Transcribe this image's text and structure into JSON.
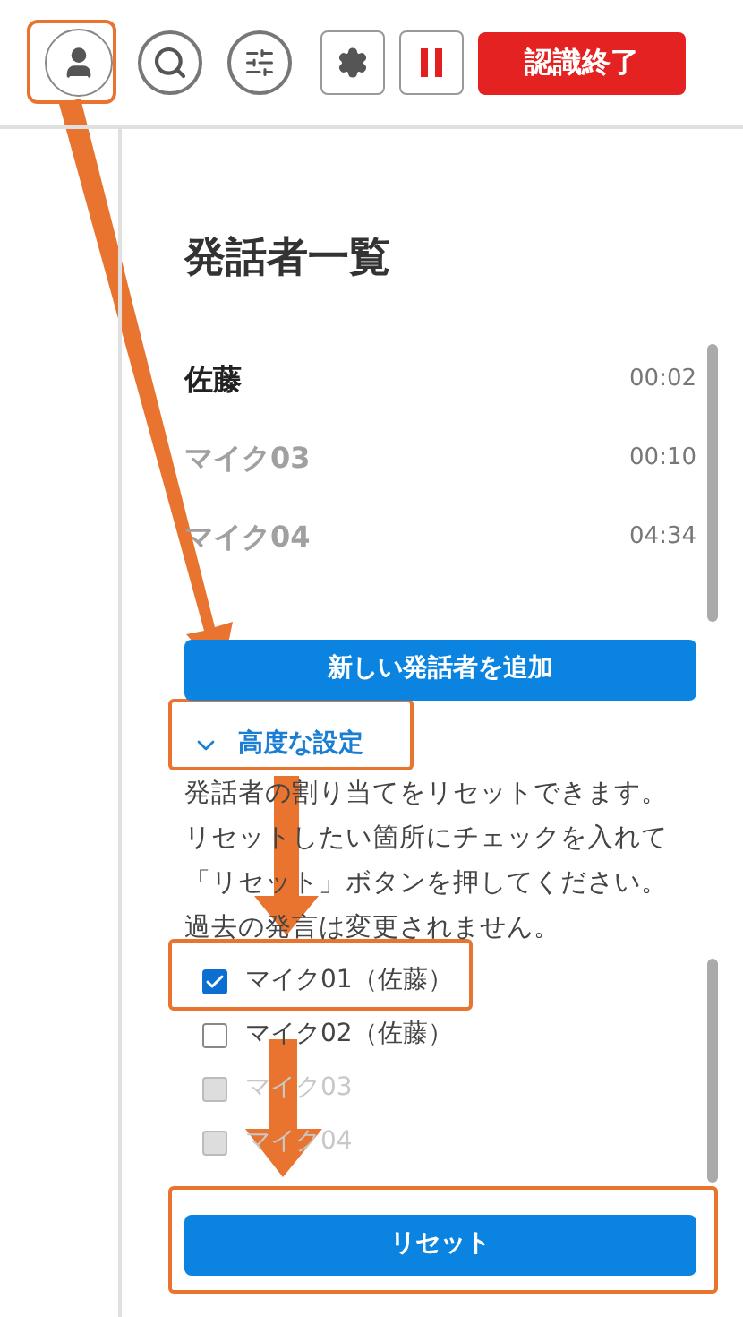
{
  "toolbar": {
    "end_button": "認識終了"
  },
  "panel": {
    "title": "発話者一覧",
    "speakers": [
      {
        "name": "佐藤",
        "time": "00:02",
        "dimmed": false
      },
      {
        "name": "マイク03",
        "time": "00:10",
        "dimmed": true
      },
      {
        "name": "マイク04",
        "time": "04:34",
        "dimmed": true
      }
    ],
    "add_button": "新しい発話者を追加",
    "advanced": {
      "label": "高度な設定",
      "expanded": true,
      "description": [
        "発話者の割り当てをリセットできます。",
        "リセットしたい箇所にチェックを入れて",
        "「リセット」ボタンを押してください。",
        "過去の発言は変更されません。"
      ],
      "items": [
        {
          "label": "マイク01（佐藤）",
          "checked": true,
          "disabled": false
        },
        {
          "label": "マイク02（佐藤）",
          "checked": false,
          "disabled": false
        },
        {
          "label": "マイク03",
          "checked": false,
          "disabled": true
        },
        {
          "label": "マイク04",
          "checked": false,
          "disabled": true
        }
      ],
      "reset_button": "リセット"
    }
  }
}
